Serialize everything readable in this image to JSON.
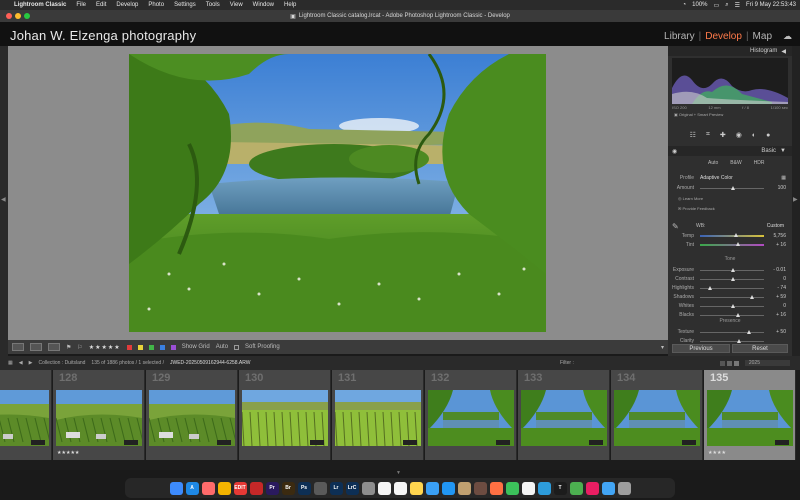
{
  "menubar": {
    "app_name": "Lightroom Classic",
    "items": [
      "File",
      "Edit",
      "Develop",
      "Photo",
      "Settings",
      "Tools",
      "View",
      "Window",
      "Help"
    ],
    "battery": "100%",
    "datetime": "Fri 9 May  22:53:43"
  },
  "window": {
    "title": "Lightroom Classic catalog.lrcat - Adobe Photoshop Lightroom Classic - Develop"
  },
  "identity_plate": "Johan W. Elzenga photography",
  "modules": {
    "library": "Library",
    "sep": "|",
    "develop": "Develop",
    "map": "Map"
  },
  "toolbar": {
    "stars": "★★★★★",
    "show_grid": "Show Grid",
    "auto": "Auto",
    "soft_proofing": "Soft Proofing",
    "label_colors": [
      "#e23b3b",
      "#e8d23a",
      "#42b648",
      "#3a7fe0",
      "#9b4fd6"
    ]
  },
  "histogram": {
    "title": "Histogram",
    "meta": [
      "ISO 200",
      "12 mm",
      "f / 8",
      "1/100 sec"
    ],
    "preview_label": "Original + Smart Preview"
  },
  "basic": {
    "title": "Basic",
    "auto_label": "Auto",
    "bw_label": "B&W",
    "hdr_label": "HDR",
    "profile_label": "Profile",
    "profile_value": "Adaptive Color",
    "amount_label": "Amount",
    "amount_value": "100",
    "learn_more": "Learn More",
    "feedback": "Provide Feedback",
    "wb_label": "WB:",
    "wb_value": "Custom",
    "temp_label": "Temp",
    "temp_value": "5,756",
    "tint_label": "Tint",
    "tint_value": "+ 16",
    "tone_label": "Tone",
    "presence_label": "Presence",
    "tone_sliders": [
      {
        "label": "Exposure",
        "value": "- 0.01",
        "pos": 0.5
      },
      {
        "label": "Contrast",
        "value": "0",
        "pos": 0.5
      },
      {
        "label": "Highlights",
        "value": "- 74",
        "pos": 0.13
      },
      {
        "label": "Shadows",
        "value": "+ 59",
        "pos": 0.8
      },
      {
        "label": "Whites",
        "value": "0",
        "pos": 0.5
      },
      {
        "label": "Blacks",
        "value": "+ 16",
        "pos": 0.58
      }
    ],
    "presence_sliders": [
      {
        "label": "Texture",
        "value": "+ 50",
        "pos": 0.75
      },
      {
        "label": "Clarity",
        "value": "",
        "pos": 0.6
      }
    ]
  },
  "panel_buttons": {
    "previous": "Previous",
    "reset": "Reset"
  },
  "filmstrip_header": {
    "collection": "Collection : Duitsland",
    "count": "135 of 1886 photos / 1 selected /",
    "filename": "JWED-20250509162944-6258.ARW",
    "filter_label": "Filter :",
    "year": "2025"
  },
  "filmstrip": [
    {
      "num": "",
      "stars": "★★★★★"
    },
    {
      "num": "128",
      "stars": "★★★★★"
    },
    {
      "num": "129",
      "stars": ""
    },
    {
      "num": "130",
      "stars": ""
    },
    {
      "num": "131",
      "stars": ""
    },
    {
      "num": "132",
      "stars": ""
    },
    {
      "num": "133",
      "stars": ""
    },
    {
      "num": "134",
      "stars": ""
    },
    {
      "num": "135",
      "stars": "★★★★"
    }
  ],
  "dock_icons": [
    {
      "name": "finder-icon",
      "color": "#3d8bfd",
      "label": ""
    },
    {
      "name": "app-store-icon",
      "color": "#1e88e5",
      "label": "A"
    },
    {
      "name": "launchpad-icon",
      "color": "#ff6b6b",
      "label": ""
    },
    {
      "name": "photos-icon",
      "color": "#f4b400",
      "label": ""
    },
    {
      "name": "edit-icon",
      "color": "#e53935",
      "label": "EDIT"
    },
    {
      "name": "pdf-icon",
      "color": "#c62828",
      "label": ""
    },
    {
      "name": "premiere-icon",
      "color": "#2a1a5e",
      "label": "Pr"
    },
    {
      "name": "bridge-icon",
      "color": "#3b2a10",
      "label": "Br"
    },
    {
      "name": "photoshop-icon",
      "color": "#0d2f55",
      "label": "Ps"
    },
    {
      "name": "cloud-icon",
      "color": "#5a5a5a",
      "label": ""
    },
    {
      "name": "lightroom-icon",
      "color": "#0d2f55",
      "label": "Lr"
    },
    {
      "name": "lightroom-classic-icon",
      "color": "#0d2f55",
      "label": "LrC"
    },
    {
      "name": "settings-icon",
      "color": "#8e8e8e",
      "label": ""
    },
    {
      "name": "calendar-icon",
      "color": "#f5f5f5",
      "label": ""
    },
    {
      "name": "reminders-icon",
      "color": "#f5f5f5",
      "label": ""
    },
    {
      "name": "notes-icon",
      "color": "#ffd54f",
      "label": ""
    },
    {
      "name": "twitterrific-icon",
      "color": "#3aa0f5",
      "label": ""
    },
    {
      "name": "mail-icon",
      "color": "#2196f3",
      "label": ""
    },
    {
      "name": "contacts-icon",
      "color": "#c0a070",
      "label": ""
    },
    {
      "name": "files-icon",
      "color": "#6d4c41",
      "label": ""
    },
    {
      "name": "firefox-icon",
      "color": "#ff7043",
      "label": ""
    },
    {
      "name": "messages-icon",
      "color": "#3cc15b",
      "label": ""
    },
    {
      "name": "chrome-icon",
      "color": "#f5f5f5",
      "label": ""
    },
    {
      "name": "safari-icon",
      "color": "#2d9cdb",
      "label": ""
    },
    {
      "name": "terminal-icon",
      "color": "#1c1c1c",
      "label": "T"
    },
    {
      "name": "activity-icon",
      "color": "#4caf50",
      "label": ""
    },
    {
      "name": "music-icon",
      "color": "#e91e63",
      "label": ""
    },
    {
      "name": "downloads-folder-icon",
      "color": "#42a5f5",
      "label": ""
    },
    {
      "name": "trash-icon",
      "color": "#9e9e9e",
      "label": ""
    }
  ]
}
